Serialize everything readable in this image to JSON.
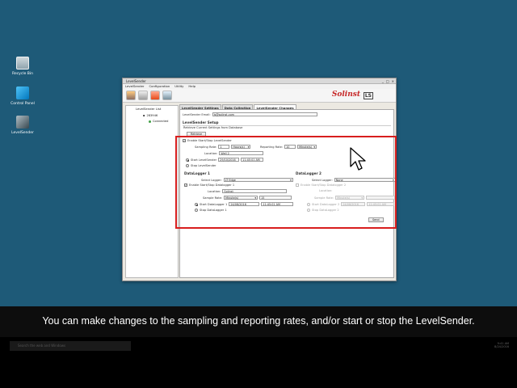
{
  "desktop": {
    "icons": [
      {
        "label": "Recycle Bin",
        "icon": "recycle-bin-icon"
      },
      {
        "label": "Control Panel",
        "icon": "control-panel-icon"
      },
      {
        "label": "LevelSender",
        "icon": "levelsender-app-icon"
      }
    ]
  },
  "window": {
    "title": "LevelSender",
    "controls": [
      "_",
      "□",
      "×"
    ],
    "menu": [
      "LevelSender",
      "Configuration",
      "Utility",
      "Help"
    ],
    "logo_text": "Solinst",
    "logo_badge": "LS"
  },
  "tree": {
    "header": "LevelSender List",
    "device": "283946",
    "status": "Connected"
  },
  "tabs": [
    "LevelSender Settings",
    "Data Collection",
    "LevelSender Changes"
  ],
  "panel": {
    "email_label": "LevelSender Email:",
    "email_value": "ls@solinst.com",
    "setup_title": "LevelSender Setup",
    "retrieve_text": "Retrieve Current Settings from Database",
    "retrieve_button": "Retrieve",
    "enable_label": "Enable Start/Stop LevelSender",
    "sampling_label": "Sampling Rate:",
    "sampling_value": "1",
    "sampling_unit": "Hours(s)",
    "reporting_label": "Reporting Rate:",
    "reporting_value": "10",
    "reporting_unit": "Minute(s)",
    "location_label": "Location:",
    "location_value": "Well 2",
    "start_label": "Start LevelSender",
    "start_date": "29/10/2016",
    "start_time": "11:45:01 AM",
    "stop_label": "Stop LevelSender",
    "dl1": {
      "title": "DataLogger 1",
      "select_label": "Select Logger:",
      "select_value": "LT Edge",
      "enable_label": "Enable Start/Stop Datalogger 1",
      "location_label": "Location:",
      "location_value": "Solinst",
      "rate_label": "Sample Rate:",
      "rate_unit": "Minute(s)",
      "rate_value": "15",
      "start_label": "Start DataLogger 1",
      "start_date": "24/08/2016",
      "start_time": "11:45:01 AM",
      "stop_label": "Stop DataLogger 1"
    },
    "dl2": {
      "title": "DataLogger 2",
      "select_label": "Select Logger:",
      "select_value": "None",
      "enable_label": "Enable Start/Stop Datalogger 2",
      "location_label": "Location:",
      "rate_label": "Sample Rate:",
      "rate_unit": "Minute(s)",
      "start_label": "Start DataLogger 2",
      "start_date": "24/08/2016",
      "start_time": "11:45:01 AM",
      "stop_label": "Stop DataLogger 2"
    },
    "send_button": "Send"
  },
  "caption": "You can make changes to the sampling and reporting rates, and/or start or stop the LevelSender.",
  "taskbar": {
    "search_placeholder": "Search the web and Windows",
    "time": "9:41 AM",
    "date": "8/24/2016"
  },
  "colors": {
    "desktop": "#1e5a78",
    "highlight": "#d81e1e",
    "brand": "#c62828"
  }
}
